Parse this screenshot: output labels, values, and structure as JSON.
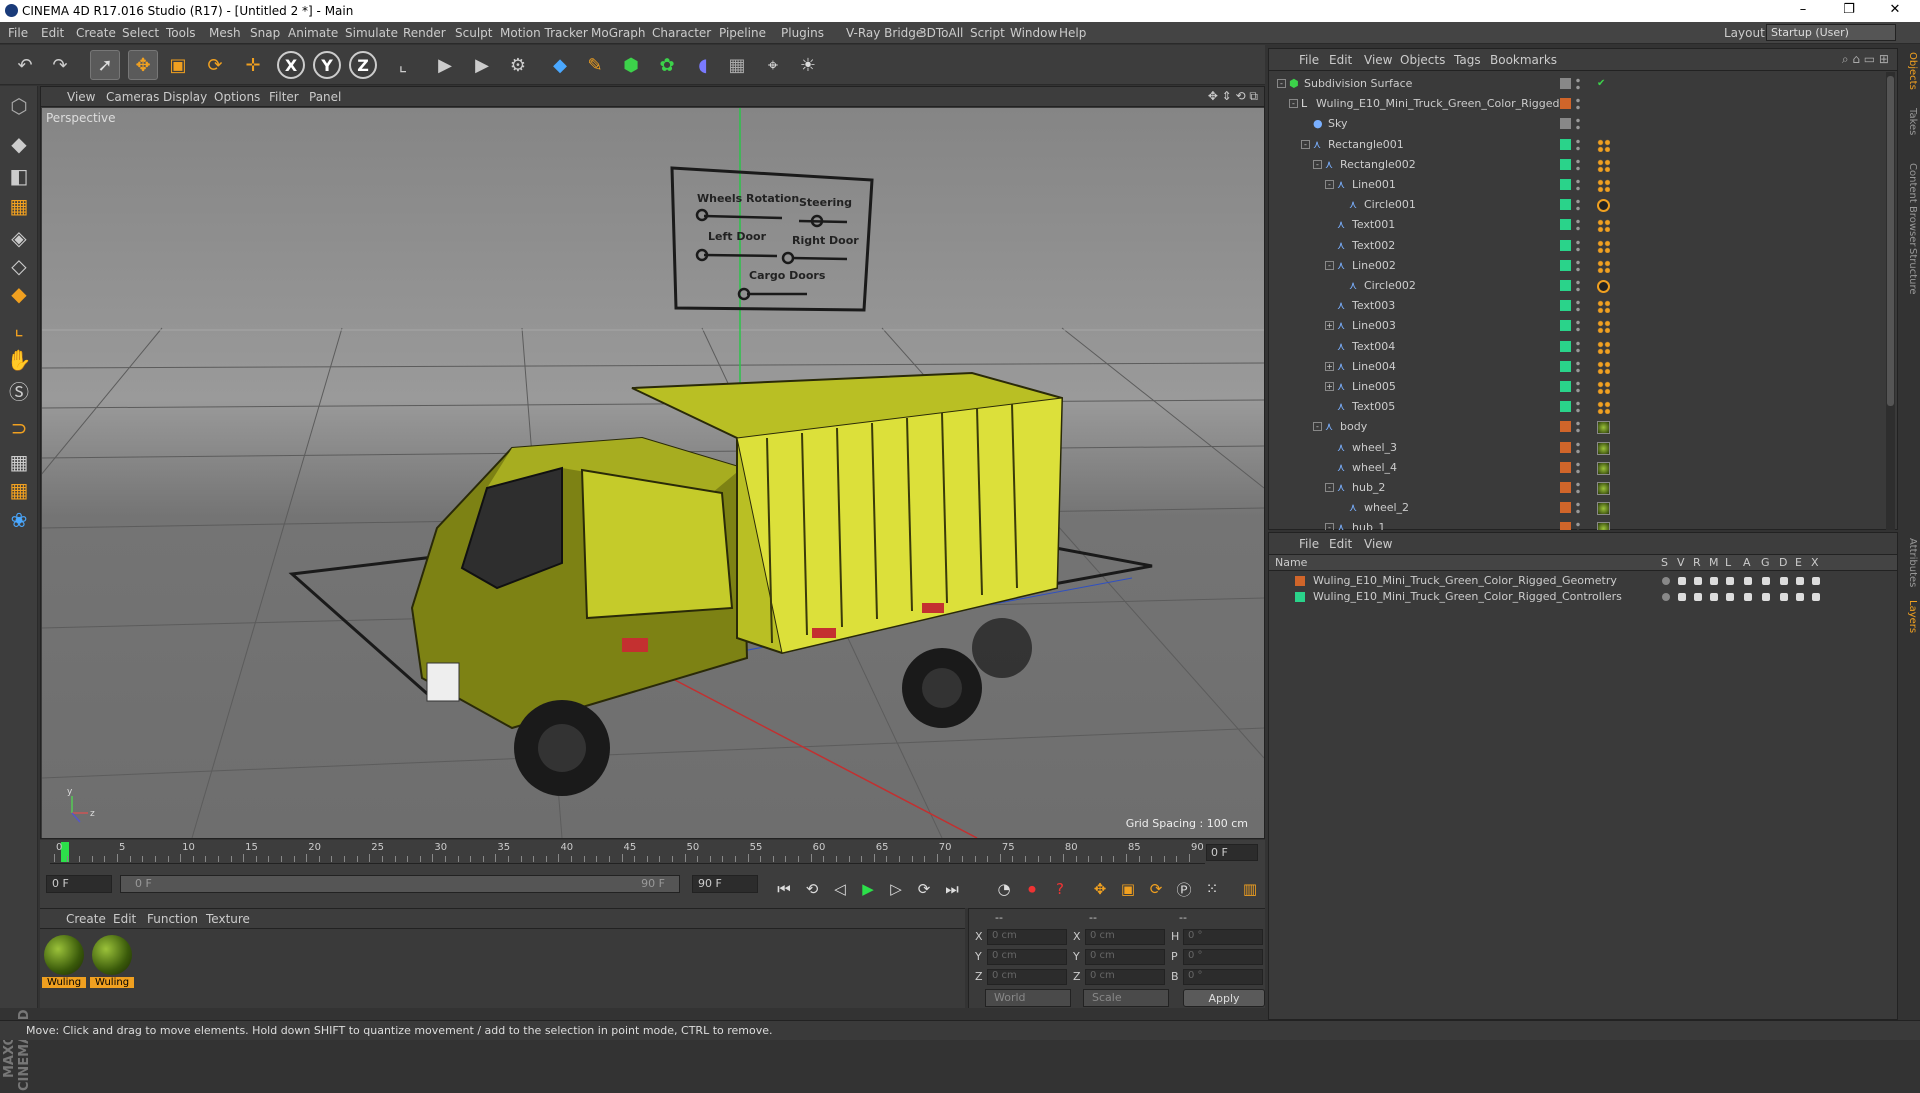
{
  "window": {
    "title": "CINEMA 4D R17.016 Studio (R17) - [Untitled 2 *] - Main",
    "controls": [
      "–",
      "❐",
      "✕"
    ]
  },
  "menubar": {
    "items": [
      "File",
      "Edit",
      "Create",
      "Select",
      "Tools",
      "Mesh",
      "Snap",
      "Animate",
      "Simulate",
      "Render",
      "Sculpt",
      "Motion Tracker",
      "MoGraph",
      "Character",
      "Pipeline",
      "Plugins",
      "V-Ray Bridge",
      "3DToAll",
      "Script",
      "Window",
      "Help"
    ],
    "layout_label": "Layout:",
    "layout_value": "Startup (User)"
  },
  "toolbar": {
    "icons": [
      "undo-icon",
      "redo-icon",
      "select-arrow-icon",
      "move-icon",
      "scale-icon",
      "rotate-icon",
      "live-select-icon",
      "x-axis-icon",
      "y-axis-icon",
      "z-axis-icon",
      "world-coord-icon",
      "render-view-icon",
      "render-pictureviewer-icon",
      "render-settings-icon",
      "cube-icon",
      "pen-icon",
      "subdivision-icon",
      "cloner-icon",
      "deformer-icon",
      "floor-icon",
      "camera-icon",
      "light-icon"
    ],
    "axes": [
      "X",
      "Y",
      "Z"
    ]
  },
  "viewport": {
    "menu": [
      "View",
      "Cameras",
      "Display",
      "Options",
      "Filter",
      "Panel"
    ],
    "camera_label": "Perspective",
    "grid_spacing": "Grid Spacing : 100 cm",
    "sign_labels": [
      "Wheels Rotation",
      "Steering",
      "Left Door",
      "Right Door",
      "Cargo Doors"
    ]
  },
  "timeline": {
    "ticks": [
      0,
      5,
      10,
      15,
      20,
      25,
      30,
      35,
      40,
      45,
      50,
      55,
      60,
      65,
      70,
      75,
      80,
      85,
      90
    ],
    "current_frame": "0 F",
    "start_field": "0 F",
    "range_start": "0 F",
    "range_end": "90 F",
    "end_field": "90 F"
  },
  "material_panel": {
    "menu": [
      "Create",
      "Edit",
      "Function",
      "Texture"
    ],
    "materials": [
      "Wuling",
      "Wuling"
    ]
  },
  "coord_panel": {
    "headers": [
      "--",
      "--",
      "--"
    ],
    "rows": [
      {
        "a": "X",
        "av": "0 cm",
        "b": "X",
        "bv": "0 cm",
        "c": "H",
        "cv": "0 °"
      },
      {
        "a": "Y",
        "av": "0 cm",
        "b": "Y",
        "bv": "0 cm",
        "c": "P",
        "cv": "0 °"
      },
      {
        "a": "Z",
        "av": "0 cm",
        "b": "Z",
        "bv": "0 cm",
        "c": "B",
        "cv": "0 °"
      }
    ],
    "world": "World",
    "scale": "Scale",
    "apply": "Apply"
  },
  "object_manager": {
    "menu": [
      "File",
      "Edit",
      "View",
      "Objects",
      "Tags",
      "Bookmarks"
    ],
    "objects": [
      {
        "name": "Subdivision Surface",
        "depth": 0,
        "layer": "#888888",
        "tree": "-"
      },
      {
        "name": "Wuling_E10_Mini_Truck_Green_Color_Rigged",
        "depth": 1,
        "layer": "#d0652a",
        "tree": "-"
      },
      {
        "name": "Sky",
        "depth": 2,
        "layer": "#888888",
        "tree": ""
      },
      {
        "name": "Rectangle001",
        "depth": 2,
        "layer": "#2ad38a",
        "tree": "-"
      },
      {
        "name": "Rectangle002",
        "depth": 3,
        "layer": "#2ad38a",
        "tree": "-"
      },
      {
        "name": "Line001",
        "depth": 4,
        "layer": "#2ad38a",
        "tree": "-"
      },
      {
        "name": "Circle001",
        "depth": 5,
        "layer": "#2ad38a",
        "tree": ""
      },
      {
        "name": "Text001",
        "depth": 4,
        "layer": "#2ad38a",
        "tree": ""
      },
      {
        "name": "Text002",
        "depth": 4,
        "layer": "#2ad38a",
        "tree": ""
      },
      {
        "name": "Line002",
        "depth": 4,
        "layer": "#2ad38a",
        "tree": "-"
      },
      {
        "name": "Circle002",
        "depth": 5,
        "layer": "#2ad38a",
        "tree": ""
      },
      {
        "name": "Text003",
        "depth": 4,
        "layer": "#2ad38a",
        "tree": ""
      },
      {
        "name": "Line003",
        "depth": 4,
        "layer": "#2ad38a",
        "tree": "+"
      },
      {
        "name": "Text004",
        "depth": 4,
        "layer": "#2ad38a",
        "tree": ""
      },
      {
        "name": "Line004",
        "depth": 4,
        "layer": "#2ad38a",
        "tree": "+"
      },
      {
        "name": "Line005",
        "depth": 4,
        "layer": "#2ad38a",
        "tree": "+"
      },
      {
        "name": "Text005",
        "depth": 4,
        "layer": "#2ad38a",
        "tree": ""
      },
      {
        "name": "body",
        "depth": 3,
        "layer": "#d0652a",
        "tree": "-"
      },
      {
        "name": "wheel_3",
        "depth": 4,
        "layer": "#d0652a",
        "tree": ""
      },
      {
        "name": "wheel_4",
        "depth": 4,
        "layer": "#d0652a",
        "tree": ""
      },
      {
        "name": "hub_2",
        "depth": 4,
        "layer": "#d0652a",
        "tree": "-"
      },
      {
        "name": "wheel_2",
        "depth": 5,
        "layer": "#d0652a",
        "tree": ""
      },
      {
        "name": "hub_1",
        "depth": 4,
        "layer": "#d0652a",
        "tree": "-"
      }
    ]
  },
  "layer_manager": {
    "menu": [
      "File",
      "Edit",
      "View"
    ],
    "header": {
      "name": "Name",
      "cols": [
        "S",
        "V",
        "R",
        "M",
        "L",
        "A",
        "G",
        "D",
        "E",
        "X"
      ]
    },
    "layers": [
      {
        "name": "Wuling_E10_Mini_Truck_Green_Color_Rigged_Geometry",
        "color": "#d0652a"
      },
      {
        "name": "Wuling_E10_Mini_Truck_Green_Color_Rigged_Controllers",
        "color": "#2ad38a"
      }
    ]
  },
  "side_tabs": [
    "Objects",
    "Takes",
    "Content Browser",
    "Structure",
    "Attributes",
    "Layers"
  ],
  "status": "Move: Click and drag to move elements. Hold down SHIFT to quantize movement / add to the selection in point mode, CTRL to remove."
}
